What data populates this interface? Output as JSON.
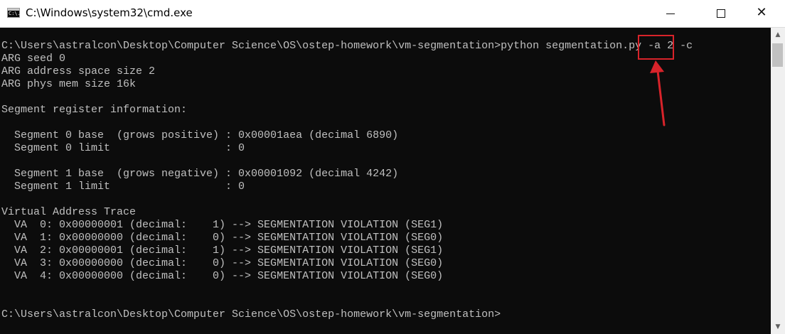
{
  "window": {
    "title": "C:\\Windows\\system32\\cmd.exe",
    "icon": "cmd-icon",
    "icon_text": "C:\\.",
    "controls": {
      "minimize": "minimize-icon",
      "maximize": "maximize-icon",
      "close": "✕"
    }
  },
  "console": {
    "lines": [
      "C:\\Users\\astralcon\\Desktop\\Computer Science\\OS\\ostep-homework\\vm-segmentation>python segmentation.py -a 2 -c",
      "ARG seed 0",
      "ARG address space size 2",
      "ARG phys mem size 16k",
      "",
      "Segment register information:",
      "",
      "  Segment 0 base  (grows positive) : 0x00001aea (decimal 6890)",
      "  Segment 0 limit                  : 0",
      "",
      "  Segment 1 base  (grows negative) : 0x00001092 (decimal 4242)",
      "  Segment 1 limit                  : 0",
      "",
      "Virtual Address Trace",
      "  VA  0: 0x00000001 (decimal:    1) --> SEGMENTATION VIOLATION (SEG1)",
      "  VA  1: 0x00000000 (decimal:    0) --> SEGMENTATION VIOLATION (SEG0)",
      "  VA  2: 0x00000001 (decimal:    1) --> SEGMENTATION VIOLATION (SEG1)",
      "  VA  3: 0x00000000 (decimal:    0) --> SEGMENTATION VIOLATION (SEG0)",
      "  VA  4: 0x00000000 (decimal:    0) --> SEGMENTATION VIOLATION (SEG0)",
      "",
      "",
      "C:\\Users\\astralcon\\Desktop\\Computer Science\\OS\\ostep-homework\\vm-segmentation>"
    ]
  },
  "scrollbar": {
    "up_icon": "▲",
    "down_icon": "▼"
  },
  "annotation": {
    "highlight_color": "#d8232a"
  }
}
